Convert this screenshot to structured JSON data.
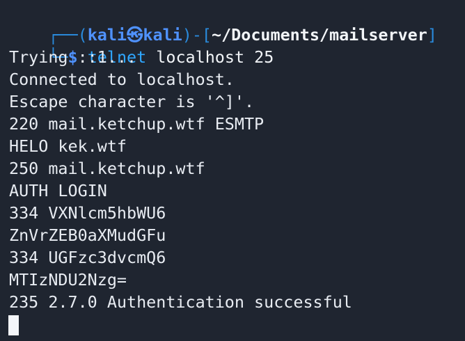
{
  "terminal": {
    "prompt": {
      "frame_top_left": "┌──(",
      "user": "kali",
      "separator_icon": "㉿",
      "host": "kali",
      "frame_mid": ")-[",
      "cwd": "~/Documents/mailserver",
      "frame_close": "]",
      "frame_bottom_left": "└─",
      "symbol": "$",
      "command": "telnet",
      "arguments": "localhost 25"
    },
    "output": [
      "Trying ::1...",
      "Connected to localhost.",
      "Escape character is '^]'.",
      "220 mail.ketchup.wtf ESMTP",
      "HELO kek.wtf",
      "250 mail.ketchup.wtf",
      "AUTH LOGIN",
      "334 VXNlcm5hbWU6",
      "ZnVrZEB0aXMudGFu",
      "334 UGFzc3dvcmQ6",
      "MTIzNDU2Nzg=",
      "235 2.7.0 Authentication successful"
    ],
    "colors": {
      "background": "#1f2530",
      "prompt_blue": "#4f92ff",
      "command_blue": "#2fa7ff",
      "text": "#e8ecf2"
    }
  }
}
